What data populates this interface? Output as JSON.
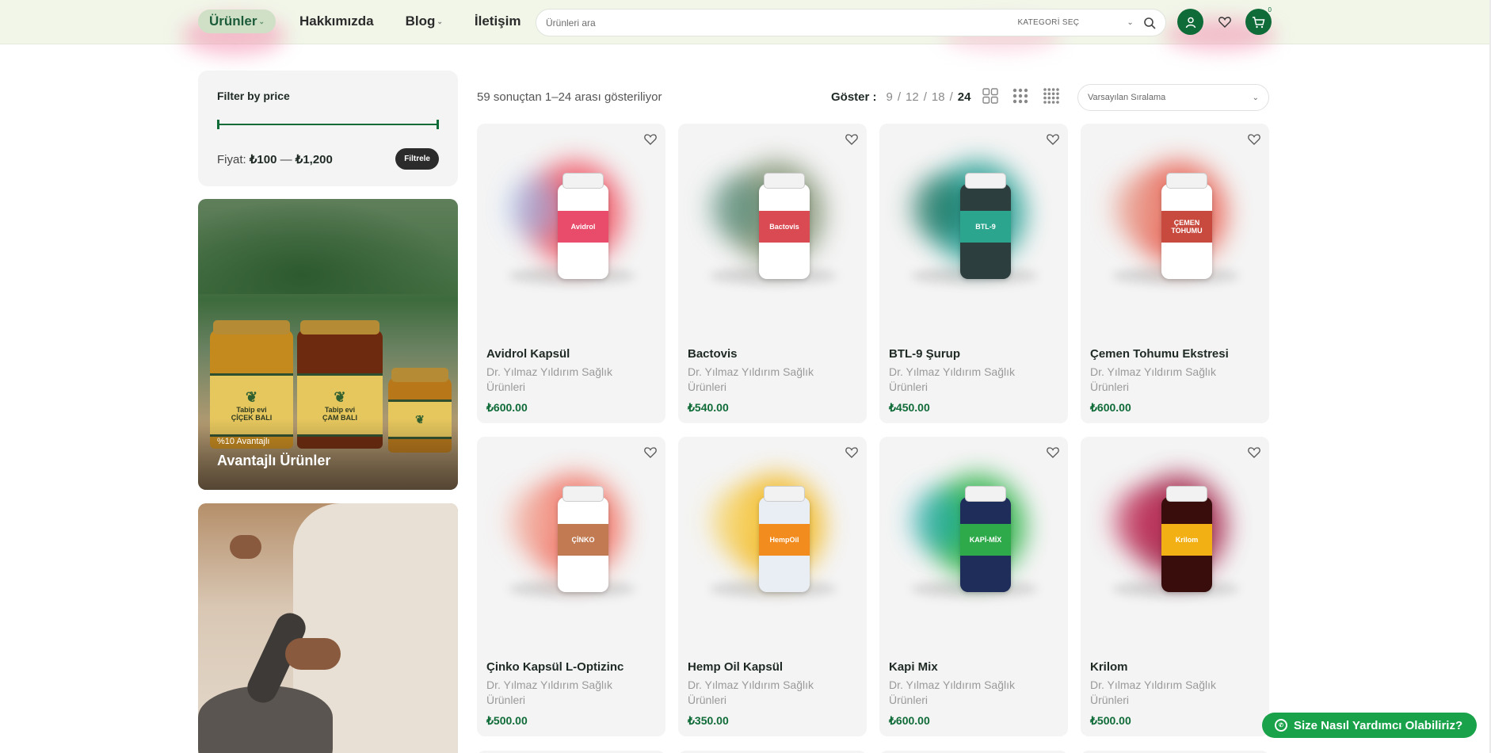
{
  "nav": {
    "items": [
      {
        "label": "Ürünler",
        "active": true,
        "dropdown": true
      },
      {
        "label": "Hakkımızda",
        "active": false,
        "dropdown": false
      },
      {
        "label": "Blog",
        "active": false,
        "dropdown": true
      },
      {
        "label": "İletişim",
        "active": false,
        "dropdown": false
      }
    ]
  },
  "search": {
    "placeholder": "Ürünleri ara",
    "category_label": "KATEGORİ SEÇ"
  },
  "header": {
    "cart_count": "0",
    "accent_color": "#0f6b38"
  },
  "sidebar": {
    "filter_title": "Filter by price",
    "price_label": "Fiyat:",
    "price_min": "₺100",
    "price_sep": "—",
    "price_max": "₺1,200",
    "filter_button": "Filtrele",
    "promo1_sub": "%10 Avantajlı",
    "promo1_title": "Avantajlı Ürünler",
    "jar1_label": "ÇİÇEK BALI",
    "jar2_label": "ÇAM BALI",
    "jar_brand": "Tabip evi"
  },
  "toolbar": {
    "result_count": "59 sonuçtan 1–24 arası gösteriliyor",
    "show_label": "Göster :",
    "show_options": [
      "9",
      "12",
      "18",
      "24"
    ],
    "show_selected": "24",
    "sort_label": "Varsayılan Sıralama"
  },
  "products": [
    {
      "name": "Avidrol Kapsül",
      "brand": "Dr. Yılmaz Yıldırım Sağlık Ürünleri",
      "price": "₺600.00",
      "glow": "#f04a5a",
      "glow2": "#8fb0e6",
      "box_color": "#ffffff",
      "accent": "#e94b6a",
      "pkg_text": "Avidrol"
    },
    {
      "name": "Bactovis",
      "brand": "Dr. Yılmaz Yıldırım Sağlık Ürünleri",
      "price": "₺540.00",
      "glow": "#7e8f6f",
      "glow2": "#4f8a7a",
      "box_color": "#ffffff",
      "accent": "#d94a52",
      "pkg_text": "Bactovis"
    },
    {
      "name": "BTL-9 Şurup",
      "brand": "Dr. Yılmaz Yıldırım Sağlık Ürünleri",
      "price": "₺450.00",
      "glow": "#1a9a8e",
      "glow2": "#136a55",
      "box_color": "#2c3e3e",
      "accent": "#2ca58e",
      "pkg_text": "BTL-9"
    },
    {
      "name": "Çemen Tohumu Ekstresi",
      "brand": "Dr. Yılmaz Yıldırım Sağlık Ürünleri",
      "price": "₺600.00",
      "glow": "#e85a4a",
      "glow2": "#e8a090",
      "box_color": "#ffffff",
      "accent": "#c84a3e",
      "pkg_text": "ÇEMEN TOHUMU"
    },
    {
      "name": "Çinko Kapsül L-Optizinc",
      "brand": "Dr. Yılmaz Yıldırım Sağlık Ürünleri",
      "price": "₺500.00",
      "glow": "#f06a5a",
      "glow2": "#f2b0a0",
      "box_color": "#ffffff",
      "accent": "#c27a52",
      "pkg_text": "ÇİNKO"
    },
    {
      "name": "Hemp Oil Kapsül",
      "brand": "Dr. Yılmaz Yıldırım Sağlık Ürünleri",
      "price": "₺350.00",
      "glow": "#f2b618",
      "glow2": "#f7d56a",
      "box_color": "#e9eef5",
      "accent": "#f28c1e",
      "pkg_text": "HempOil"
    },
    {
      "name": "Kapi Mix",
      "brand": "Dr. Yılmaz Yıldırım Sağlık Ürünleri",
      "price": "₺600.00",
      "glow": "#1fae3c",
      "glow2": "#18a5b0",
      "box_color": "#1e2d5a",
      "accent": "#2eaa4a",
      "pkg_text": "KAPİ-MİX"
    },
    {
      "name": "Krilom",
      "brand": "Dr. Yılmaz Yıldırım Sağlık Ürünleri",
      "price": "₺500.00",
      "glow": "#a01840",
      "glow2": "#c4305a",
      "box_color": "#3a0d0d",
      "accent": "#f2b014",
      "pkg_text": "Krilom"
    }
  ],
  "help": {
    "label": "Size Nasıl Yardımcı Olabiliriz?"
  }
}
